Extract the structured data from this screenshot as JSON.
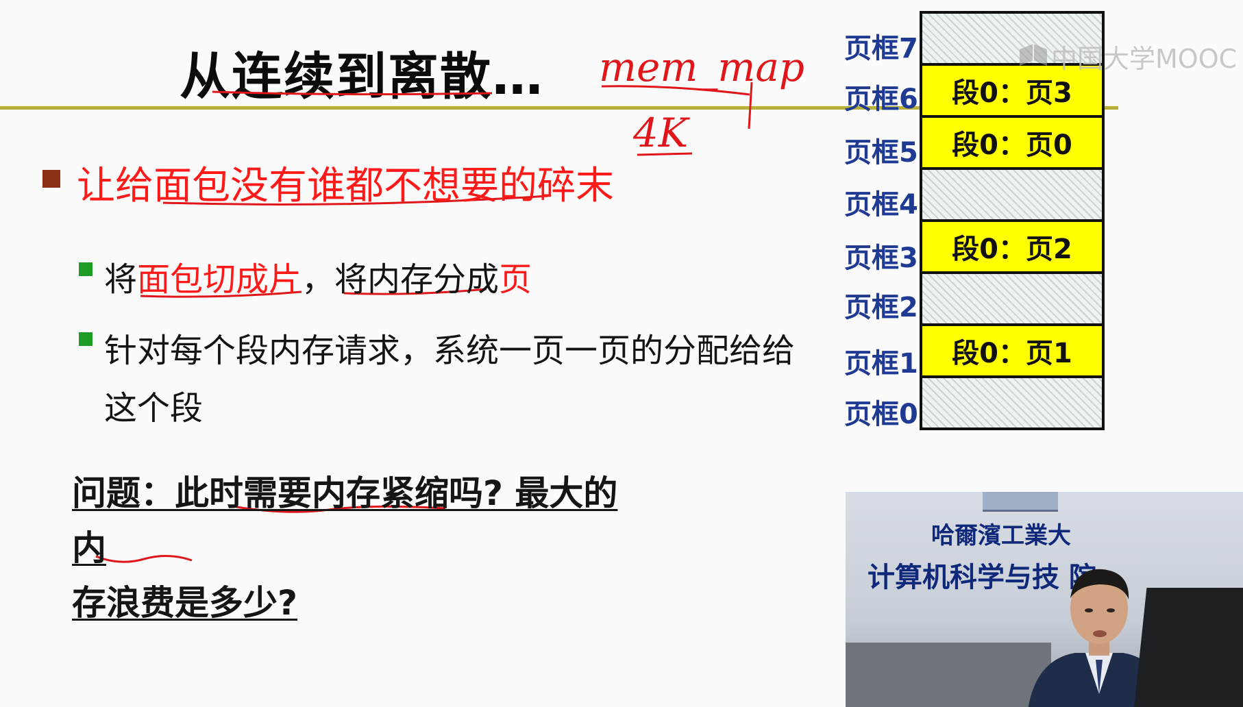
{
  "slide": {
    "title": "从连续到离散…",
    "main_point": "让给面包没有谁都不想要的碎末",
    "sub_points": [
      {
        "parts": [
          {
            "text": "将",
            "red": false
          },
          {
            "text": "面包切成片",
            "red": true
          },
          {
            "text": "，将内存分成",
            "red": false
          },
          {
            "text": "页",
            "red": true
          }
        ]
      },
      {
        "line1": "针对每个段内存请求，系统一页一页的分配给给",
        "line2": "这个段"
      }
    ],
    "question_line1": "问题：此时需要内存紧缩吗? 最大的内",
    "question_line2": "存浪费是多少?"
  },
  "annotations": {
    "handwritten_top": "mem_map",
    "handwritten_bottom": "4K"
  },
  "frames": [
    {
      "label": "页框7",
      "content": "",
      "used": false
    },
    {
      "label": "页框6",
      "content": "段0：页3",
      "used": true
    },
    {
      "label": "页框5",
      "content": "段0：页0",
      "used": true
    },
    {
      "label": "页框4",
      "content": "",
      "used": false
    },
    {
      "label": "页框3",
      "content": "段0：页2",
      "used": true
    },
    {
      "label": "页框2",
      "content": "",
      "used": false
    },
    {
      "label": "页框1",
      "content": "段0：页1",
      "used": true
    },
    {
      "label": "页框0",
      "content": "",
      "used": false
    }
  ],
  "logo": {
    "text": "中国大学MOOC"
  },
  "video": {
    "school_sign": "哈爾濱工業大",
    "college_sign": "计算机科学与技  院"
  },
  "colors": {
    "title_rule": "#b7b03a",
    "red_text": "#ff1a1a",
    "frame_used": "#ffff00",
    "frame_label": "#1f3a92"
  }
}
